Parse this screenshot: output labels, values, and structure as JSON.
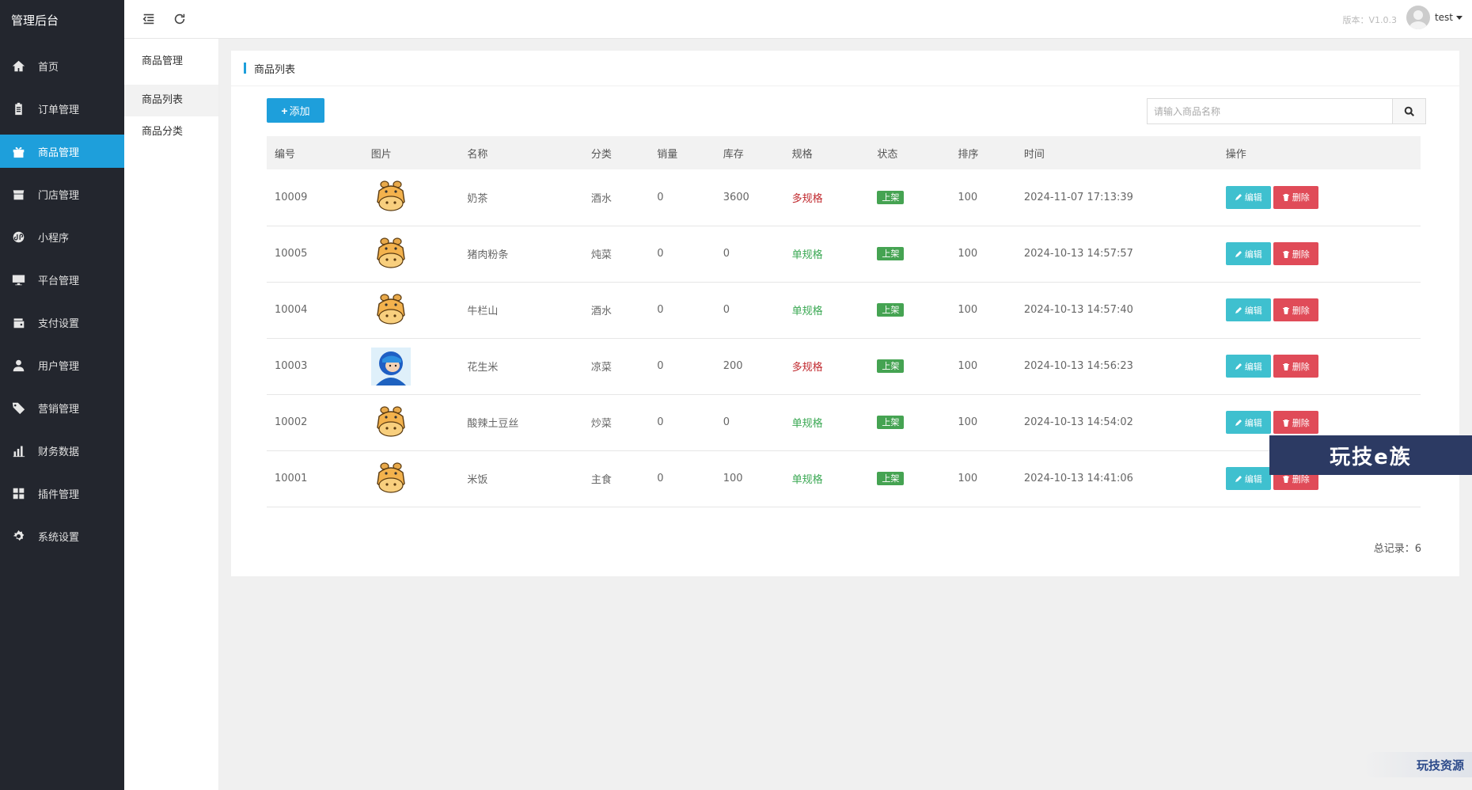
{
  "brand": "管理后台",
  "nav": [
    {
      "label": "首页",
      "icon": "home-icon"
    },
    {
      "label": "订单管理",
      "icon": "clipboard-icon"
    },
    {
      "label": "商品管理",
      "icon": "gift-icon",
      "active": true
    },
    {
      "label": "门店管理",
      "icon": "store-icon"
    },
    {
      "label": "小程序",
      "icon": "miniprogram-icon"
    },
    {
      "label": "平台管理",
      "icon": "monitor-icon"
    },
    {
      "label": "支付设置",
      "icon": "wallet-icon"
    },
    {
      "label": "用户管理",
      "icon": "user-icon"
    },
    {
      "label": "营销管理",
      "icon": "tags-icon"
    },
    {
      "label": "财务数据",
      "icon": "bar-chart-icon"
    },
    {
      "label": "插件管理",
      "icon": "puzzle-icon"
    },
    {
      "label": "系统设置",
      "icon": "gear-icon"
    }
  ],
  "subnav": {
    "title": "商品管理",
    "items": [
      "商品列表",
      "商品分类"
    ]
  },
  "header": {
    "version": "版本：V1.0.3",
    "user": "test"
  },
  "card": {
    "title": "商品列表",
    "add_label": "添加",
    "search_placeholder": "请输入商品名称",
    "total_label": "总记录：6"
  },
  "table": {
    "columns": [
      "编号",
      "图片",
      "名称",
      "分类",
      "销量",
      "库存",
      "规格",
      "状态",
      "排序",
      "时间",
      "操作"
    ],
    "edit_label": "编辑",
    "delete_label": "删除",
    "rows": [
      {
        "id": "10009",
        "image": "hippo",
        "name": "奶茶",
        "category": "酒水",
        "sales": "0",
        "stock": "3600",
        "spec": "多规格",
        "spec_type": "multi",
        "status": "上架",
        "sort": "100",
        "time": "2024-11-07 17:13:39"
      },
      {
        "id": "10005",
        "image": "hippo",
        "name": "猪肉粉条",
        "category": "炖菜",
        "sales": "0",
        "stock": "0",
        "spec": "单规格",
        "spec_type": "single",
        "status": "上架",
        "sort": "100",
        "time": "2024-10-13 14:57:57"
      },
      {
        "id": "10004",
        "image": "hippo",
        "name": "牛栏山",
        "category": "酒水",
        "sales": "0",
        "stock": "0",
        "spec": "单规格",
        "spec_type": "single",
        "status": "上架",
        "sort": "100",
        "time": "2024-10-13 14:57:40"
      },
      {
        "id": "10003",
        "image": "helmet-character",
        "name": "花生米",
        "category": "凉菜",
        "sales": "0",
        "stock": "200",
        "spec": "多规格",
        "spec_type": "multi",
        "status": "上架",
        "sort": "100",
        "time": "2024-10-13 14:56:23"
      },
      {
        "id": "10002",
        "image": "hippo",
        "name": "酸辣土豆丝",
        "category": "炒菜",
        "sales": "0",
        "stock": "0",
        "spec": "单规格",
        "spec_type": "single",
        "status": "上架",
        "sort": "100",
        "time": "2024-10-13 14:54:02"
      },
      {
        "id": "10001",
        "image": "hippo",
        "name": "米饭",
        "category": "主食",
        "sales": "0",
        "stock": "100",
        "spec": "单规格",
        "spec_type": "single",
        "status": "上架",
        "sort": "100",
        "time": "2024-10-13 14:41:06"
      }
    ]
  },
  "watermarks": {
    "banner": "玩技e族",
    "corner": "玩技资源"
  },
  "colors": {
    "sidebar_bg": "#23262e",
    "accent": "#1e9fdb",
    "status_green": "#45a352",
    "edit_cyan": "#3fc0cf",
    "delete_red": "#e04b58",
    "spec_multi": "#c0282d",
    "spec_single": "#3aa853"
  }
}
